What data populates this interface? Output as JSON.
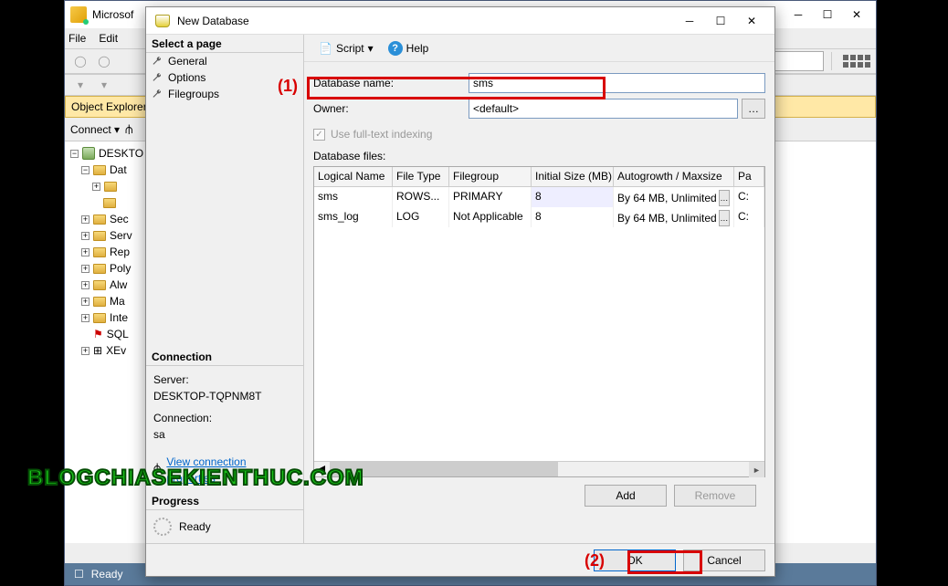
{
  "ssms": {
    "title": "Microsof",
    "menu": {
      "file": "File",
      "edit": "Edit"
    },
    "explorer_header": "Object Explorer",
    "connect_label": "Connect ▾",
    "tree": {
      "root": "DESKTO",
      "databases": "Dat",
      "security": "Sec",
      "server": "Serv",
      "replication": "Rep",
      "poly": "Poly",
      "always": "Alw",
      "management": "Ma",
      "integration": "Inte",
      "sql": "SQL",
      "xev": "XEv"
    },
    "status": "Ready"
  },
  "dialog": {
    "title": "New Database",
    "pages_header": "Select a page",
    "pages": {
      "general": "General",
      "options": "Options",
      "filegroups": "Filegroups"
    },
    "connection_header": "Connection",
    "server_label": "Server:",
    "server_value": "DESKTOP-TQPNM8T",
    "connection_label": "Connection:",
    "connection_value": "sa",
    "view_conn_link": "View connection properties",
    "progress_header": "Progress",
    "progress_value": "Ready",
    "toolbar": {
      "script": "Script",
      "help": "Help"
    },
    "form": {
      "dbname_label": "Database name:",
      "dbname_value": "sms",
      "owner_label": "Owner:",
      "owner_value": "<default>",
      "fulltext_label": "Use full-text indexing",
      "files_label": "Database files:"
    },
    "grid": {
      "headers": {
        "c1": "Logical Name",
        "c2": "File Type",
        "c3": "Filegroup",
        "c4": "Initial Size (MB)",
        "c5": "Autogrowth / Maxsize",
        "c6": "Pa"
      },
      "rows": [
        {
          "name": "sms",
          "type": "ROWS...",
          "fg": "PRIMARY",
          "size": "8",
          "auto": "By 64 MB, Unlimited",
          "path": "C:"
        },
        {
          "name": "sms_log",
          "type": "LOG",
          "fg": "Not Applicable",
          "size": "8",
          "auto": "By 64 MB, Unlimited",
          "path": "C:"
        }
      ]
    },
    "buttons": {
      "add": "Add",
      "remove": "Remove",
      "ok": "OK",
      "cancel": "Cancel"
    }
  },
  "annotations": {
    "a1": "(1)",
    "a2": "(2)"
  },
  "watermark": "BLOGCHIASEKIENTHUC.COM"
}
